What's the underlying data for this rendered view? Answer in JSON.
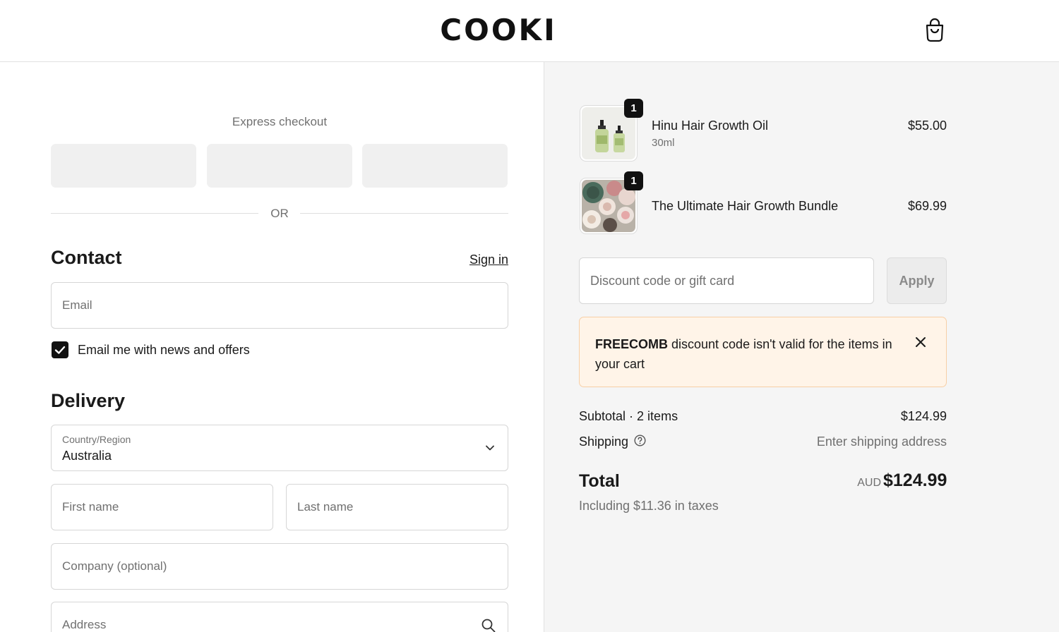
{
  "header": {
    "logo": "COOKI",
    "cart_icon": "shopping-bag-icon"
  },
  "express": {
    "title": "Express checkout",
    "divider": "OR"
  },
  "contact": {
    "title": "Contact",
    "sign_in": "Sign in",
    "email_placeholder": "Email",
    "newsletter_label": "Email me with news and offers",
    "newsletter_checked": true
  },
  "delivery": {
    "title": "Delivery",
    "country_label": "Country/Region",
    "country_value": "Australia",
    "first_name_placeholder": "First name",
    "last_name_placeholder": "Last name",
    "company_placeholder": "Company (optional)",
    "address_placeholder": "Address"
  },
  "cart": {
    "items": [
      {
        "name": "Hinu Hair Growth Oil",
        "variant": "30ml",
        "price": "$55.00",
        "quantity": "1"
      },
      {
        "name": "The Ultimate Hair Growth Bundle",
        "variant": "",
        "price": "$69.99",
        "quantity": "1"
      }
    ]
  },
  "discount": {
    "placeholder": "Discount code or gift card",
    "apply_label": "Apply",
    "error_code": "FREECOMB",
    "error_message": " discount code isn't valid for the items in your cart"
  },
  "summary": {
    "subtotal_label": "Subtotal · 2 items",
    "subtotal_value": "$124.99",
    "shipping_label": "Shipping",
    "shipping_value": "Enter shipping address",
    "total_label": "Total",
    "currency": "AUD",
    "total_value": "$124.99",
    "taxes_note": "Including $11.36 in taxes"
  },
  "colors": {
    "accent": "#111111",
    "alert_bg": "#fff4e8",
    "alert_border": "#f7cfa6",
    "panel_bg": "#f5f5f5"
  }
}
